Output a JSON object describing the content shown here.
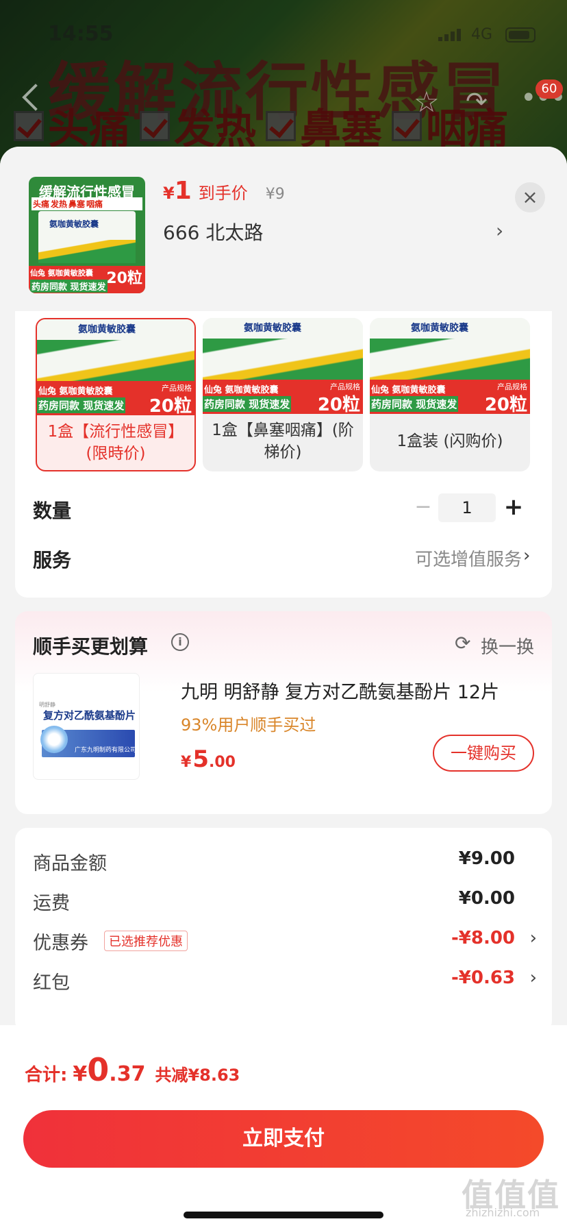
{
  "status_bar": {
    "time": "14:55",
    "network": "4G"
  },
  "background": {
    "banner_title": "缓解流行性感冒",
    "banner_symptoms": [
      "头痛",
      "发热",
      "鼻塞",
      "咽痛"
    ],
    "badge_count": "60"
  },
  "header": {
    "thumb": {
      "title": "缓解流行性感冒",
      "tags": [
        "头痛",
        "发热",
        "鼻塞",
        "咽痛"
      ],
      "box_name": "氨咖黄敏胶囊",
      "brand_line": "仙兔 氨咖黄敏胶囊",
      "promo": "药房同款 现货速发",
      "spec_label": "产品规格",
      "spec_count": "20粒"
    },
    "price_yen": "¥",
    "price_value": "1",
    "price_label": "到手价",
    "original_price": "¥9",
    "address": "666  北太路",
    "address_arrow": "›",
    "close": "×"
  },
  "spec": {
    "options": [
      {
        "image": {
          "box_name": "氨咖黄敏胶囊",
          "brand_line": "仙兔 氨咖黄敏胶囊",
          "promo": "药房同款 现货速发",
          "spec_label": "产品规格",
          "spec_count": "20粒"
        },
        "label": "1盒【流行性感冒】(限時价)",
        "selected": true
      },
      {
        "image": {
          "box_name": "氨咖黄敏胶囊",
          "brand_line": "仙兔 氨咖黄敏胶囊",
          "promo": "药房同款 现货速发",
          "spec_label": "产品规格",
          "spec_count": "20粒"
        },
        "label": "1盒【鼻塞咽痛】(阶梯价)",
        "selected": false
      },
      {
        "image": {
          "box_name": "氨咖黄敏胶囊",
          "brand_line": "仙兔 氨咖黄敏胶囊",
          "promo": "药房同款 现货速发",
          "spec_label": "产品规格",
          "spec_count": "20粒"
        },
        "label": "1盒装 (闪购价)",
        "selected": false
      }
    ],
    "quantity_label": "数量",
    "quantity_minus": "−",
    "quantity_value": "1",
    "quantity_plus": "+",
    "service_label": "服务",
    "service_value": "可选增值服务",
    "service_arrow": "›"
  },
  "cross_sell": {
    "title": "顺手买更划算",
    "info_icon": "i",
    "swap_icon": "⟳",
    "swap_label": "换一换",
    "product": {
      "image_name": "复方对乙酰氨基酚片",
      "image_top": "明舒静",
      "image_foot": "广东九明制药有限公司",
      "name": "九明 明舒静 复方对乙酰氨基酚片 12片",
      "bought": "93%用户顺手买过",
      "price_yen": "¥",
      "price_int": "5",
      "price_dec": ".00",
      "buy_label": "一键购买"
    }
  },
  "summary": {
    "rows": [
      {
        "label": "商品金额",
        "tag": "",
        "value": "¥9.00",
        "red": false,
        "arrow": ""
      },
      {
        "label": "运费",
        "tag": "",
        "value": "¥0.00",
        "red": false,
        "arrow": ""
      },
      {
        "label": "优惠券",
        "tag": "已选推荐优惠",
        "value": "-¥8.00",
        "red": true,
        "arrow": "›"
      },
      {
        "label": "红包",
        "tag": "",
        "value": "-¥0.63",
        "red": true,
        "arrow": "›"
      }
    ]
  },
  "bottom": {
    "total_label": "合计:",
    "total_yen": "¥",
    "total_int": "0",
    "total_dec": ".37",
    "saved": "共减¥8.63",
    "pay_label": "立即支付",
    "watermark": "值值值",
    "watermark_sub": "zhizhizhi.com"
  },
  "colors": {
    "accent": "#e4312a",
    "orange": "#d9862a",
    "background": "#f3f3f3"
  }
}
